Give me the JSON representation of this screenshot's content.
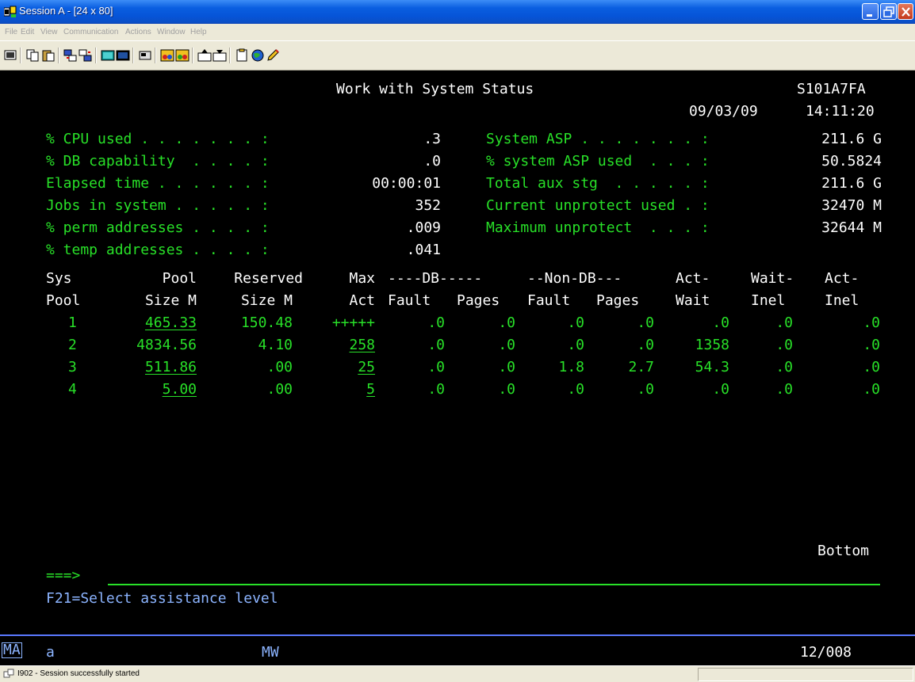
{
  "window": {
    "title": "Session A - [24 x 80]",
    "menu": [
      "File",
      "Edit",
      "View",
      "Communication",
      "Actions",
      "Window",
      "Help"
    ]
  },
  "toolbar": {
    "icons": [
      "display-icon",
      "copy-icon",
      "paste-icon",
      "send-icon",
      "receive-icon",
      "screen-icon",
      "screen2-icon",
      "macro-icon",
      "record-icon",
      "play-icon",
      "transfer-up-icon",
      "transfer-down-icon",
      "clipboard-icon",
      "globe-icon",
      "edit-icon"
    ]
  },
  "screen": {
    "title": "Work with System Status",
    "system_name": "S101A7FA",
    "date": "09/03/09",
    "time": "14:11:20",
    "left_metrics": [
      {
        "label": "% CPU used . . . . . . . :",
        "value": ".3"
      },
      {
        "label": "% DB capability  . . . . :",
        "value": ".0"
      },
      {
        "label": "Elapsed time . . . . . . :",
        "value": "00:00:01"
      },
      {
        "label": "Jobs in system . . . . . :",
        "value": "352"
      },
      {
        "label": "% perm addresses . . . . :",
        "value": ".009"
      },
      {
        "label": "% temp addresses . . . . :",
        "value": ".041"
      }
    ],
    "right_metrics": [
      {
        "label": "System ASP . . . . . . . :",
        "value": "211.6 G"
      },
      {
        "label": "% system ASP used  . . . :",
        "value": "50.5824"
      },
      {
        "label": "Total aux stg  . . . . . :",
        "value": "211.6 G"
      },
      {
        "label": "Current unprotect used . :",
        "value": "32470 M"
      },
      {
        "label": "Maximum unprotect  . . . :",
        "value": "32644 M"
      }
    ],
    "header_row1": [
      "Sys",
      "Pool",
      "Reserved",
      "Max",
      "----DB-----",
      "--Non-DB---",
      "Act-",
      "Wait-",
      "Act-"
    ],
    "header_row2": [
      "Pool",
      "Size M",
      "Size M",
      "Act",
      "Fault",
      "Pages",
      "Fault",
      "Pages",
      "Wait",
      "Inel",
      "Inel"
    ],
    "pools": [
      {
        "pool": "1",
        "size": "465.33",
        "reserved": "150.48",
        "max_act": "+++++",
        "db_fault": ".0",
        "db_pages": ".0",
        "ndb_fault": ".0",
        "ndb_pages": ".0",
        "act_wait": ".0",
        "wait_inel": ".0",
        "act_inel": ".0"
      },
      {
        "pool": "2",
        "size": "4834.56",
        "reserved": "4.10",
        "max_act": "258",
        "db_fault": ".0",
        "db_pages": ".0",
        "ndb_fault": ".0",
        "ndb_pages": ".0",
        "act_wait": "1358",
        "wait_inel": ".0",
        "act_inel": ".0"
      },
      {
        "pool": "3",
        "size": "511.86",
        "reserved": ".00",
        "max_act": "25",
        "db_fault": ".0",
        "db_pages": ".0",
        "ndb_fault": "1.8",
        "ndb_pages": "2.7",
        "act_wait": "54.3",
        "wait_inel": ".0",
        "act_inel": ".0"
      },
      {
        "pool": "4",
        "size": "5.00",
        "reserved": ".00",
        "max_act": "5",
        "db_fault": ".0",
        "db_pages": ".0",
        "ndb_fault": ".0",
        "ndb_pages": ".0",
        "act_wait": ".0",
        "wait_inel": ".0",
        "act_inel": ".0"
      }
    ],
    "bottom_label": "Bottom",
    "command_prompt": "===>",
    "command_value": "",
    "function_keys": "F21=Select assistance level"
  },
  "oia": {
    "indicator": "MA",
    "input_char": "a",
    "mode": "MW",
    "cursor_pos": "12/008"
  },
  "status": {
    "message": "I902 - Session successfully started"
  },
  "colors": {
    "terminal_green": "#28e028",
    "terminal_white": "#ffffff",
    "terminal_blue": "#8cb4ff",
    "background": "#000000"
  }
}
